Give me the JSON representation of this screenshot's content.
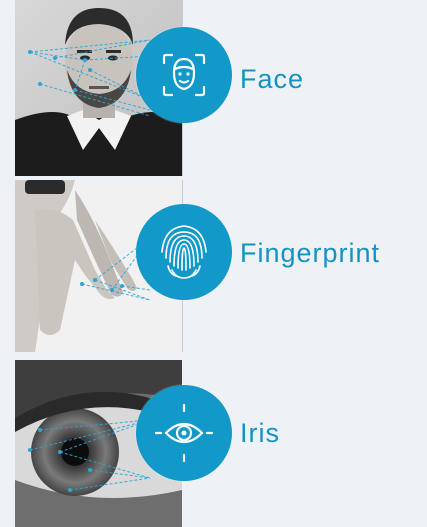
{
  "biometrics": [
    {
      "label": "Face",
      "icon": "face-scan-icon"
    },
    {
      "label": "Fingerprint",
      "icon": "fingerprint-icon"
    },
    {
      "label": "Iris",
      "icon": "eye-icon"
    }
  ],
  "colors": {
    "accent": "#1298c9",
    "label": "#1592c4",
    "background": "#eef1f5",
    "divider": "#c7ccd3"
  }
}
